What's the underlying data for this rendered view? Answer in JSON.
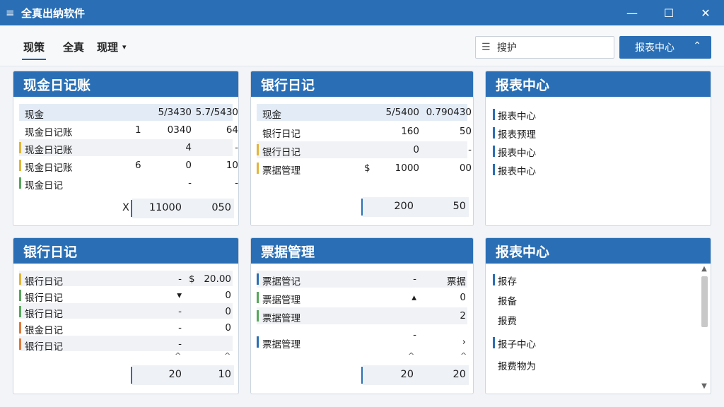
{
  "window": {
    "title": "全真出纳软件",
    "minimize": "—",
    "maximize": "☐",
    "close": "✕"
  },
  "toolbar": {
    "tabs": [
      {
        "label": "现策"
      },
      {
        "label": "全真"
      },
      {
        "label": "现理"
      }
    ],
    "tab_dropdown": "▾",
    "search": {
      "value": "搜护"
    },
    "report_button": {
      "label": "报表中心",
      "chevron": "⌃"
    }
  },
  "panels": {
    "cash_journal": {
      "title": "现金日记账",
      "header": {
        "label": "现金",
        "col1": "5/3430",
        "col2": "5.7/5430"
      },
      "rows": [
        {
          "label": "现金日记账",
          "prefix": "1",
          "col1": "0340",
          "col2": "64"
        },
        {
          "label": "现金日记账",
          "prefix": "",
          "col1": "4",
          "col2": "-"
        },
        {
          "label": "现金日记账",
          "prefix": "6",
          "col1": "0",
          "col2": "10"
        },
        {
          "label": "现金日记",
          "prefix": "",
          "col1": "-",
          "col2": "-"
        }
      ],
      "total": {
        "mark": "X",
        "col1": "11000",
        "col2": "050"
      }
    },
    "bank_journal": {
      "title": "银行日记",
      "header": {
        "label": "现金",
        "col1": "5/5400",
        "col2": "0.790430"
      },
      "rows": [
        {
          "label": "银行日记",
          "prefix": "",
          "col1": "160",
          "col2": "50"
        },
        {
          "label": "银行日记",
          "prefix": "",
          "col1": "0",
          "col2": "-"
        },
        {
          "label": "票据管理",
          "prefix": "$",
          "col1": "1000",
          "col2": "00"
        }
      ],
      "total": {
        "col1": "200",
        "col2": "50"
      }
    },
    "report_center_top": {
      "title": "报表中心",
      "items": [
        "报表中心",
        "报表预理",
        "报表中心",
        "报表中心"
      ]
    },
    "bank_journal_2": {
      "title": "银行日记",
      "rows": [
        {
          "label": "银行日记",
          "col1": "-",
          "col2": "20.00",
          "mark": "$"
        },
        {
          "label": "银行日记",
          "col1": "▾",
          "col2": "0",
          "mark": ""
        },
        {
          "label": "银行日记",
          "col1": "-",
          "col2": "0",
          "mark": ""
        },
        {
          "label": "银金日记",
          "col1": "-",
          "col2": "0",
          "mark": ""
        },
        {
          "label": "银行日记",
          "col1": "-",
          "col2": "",
          "mark": ""
        }
      ],
      "carets": {
        "col1": "^",
        "col2": "^"
      },
      "total": {
        "col1": "20",
        "col2": "10"
      }
    },
    "bill_management": {
      "title": "票据管理",
      "rows": [
        {
          "label": "票据管记",
          "col1": "-",
          "col2": "票据"
        },
        {
          "label": "票据管理",
          "col1": "▴",
          "col2": "0"
        },
        {
          "label": "票据管理",
          "col1": "",
          "col2": "2"
        },
        {
          "label": "票据管理",
          "col1": "-",
          "col2": "›"
        }
      ],
      "carets": {
        "col1": "^",
        "col2": "^"
      },
      "total": {
        "col1": "20",
        "col2": "20"
      }
    },
    "report_center_bottom": {
      "title": "报表中心",
      "items": [
        "报存",
        "报备",
        "报费",
        "报子中心",
        "报费物为"
      ]
    }
  },
  "colors": {
    "primary": "#2a6fb5",
    "bar_blue": "#2a6fb5",
    "bar_yellow": "#e0b63a",
    "bar_green": "#58a65c",
    "bar_orange": "#e0793a"
  }
}
